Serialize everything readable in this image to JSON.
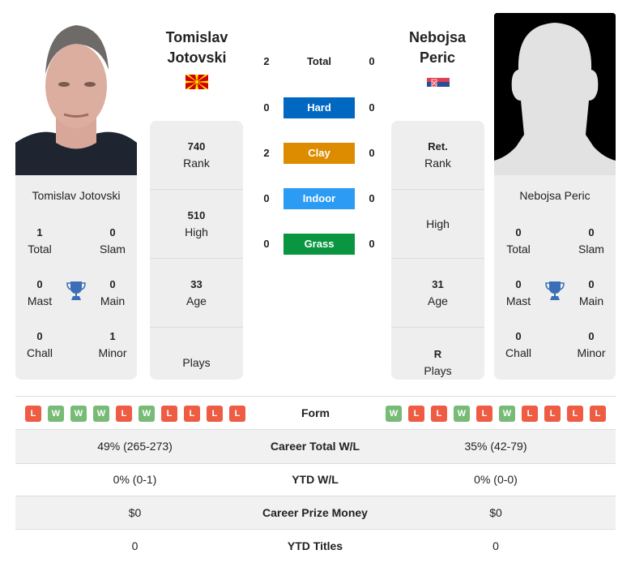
{
  "players": {
    "left": {
      "first_name": "Tomislav",
      "last_name": "Jotovski",
      "full_name": "Tomislav Jotovski",
      "country_flag": "north-macedonia-flag",
      "titles": {
        "total": "1",
        "total_label": "Total",
        "slam": "0",
        "slam_label": "Slam",
        "mast": "0",
        "mast_label": "Mast",
        "main": "0",
        "main_label": "Main",
        "chall": "0",
        "chall_label": "Chall",
        "minor": "1",
        "minor_label": "Minor"
      },
      "stats": {
        "rank": "740",
        "rank_label": "Rank",
        "high": "510",
        "high_label": "High",
        "age": "33",
        "age_label": "Age",
        "plays": "",
        "plays_label": "Plays"
      }
    },
    "right": {
      "first_name": "Nebojsa",
      "last_name": "Peric",
      "full_name": "Nebojsa Peric",
      "country_flag": "serbia-flag",
      "titles": {
        "total": "0",
        "total_label": "Total",
        "slam": "0",
        "slam_label": "Slam",
        "mast": "0",
        "mast_label": "Mast",
        "main": "0",
        "main_label": "Main",
        "chall": "0",
        "chall_label": "Chall",
        "minor": "0",
        "minor_label": "Minor"
      },
      "stats": {
        "rank": "Ret.",
        "rank_label": "Rank",
        "high": "",
        "high_label": "High",
        "age": "31",
        "age_label": "Age",
        "plays": "R",
        "plays_label": "Plays"
      }
    }
  },
  "h2h": [
    {
      "label": "Total",
      "left": "2",
      "right": "0",
      "color": ""
    },
    {
      "label": "Hard",
      "left": "0",
      "right": "0",
      "color": "#0068c0"
    },
    {
      "label": "Clay",
      "left": "2",
      "right": "0",
      "color": "#dd8c00"
    },
    {
      "label": "Indoor",
      "left": "0",
      "right": "0",
      "color": "#2b9bf4"
    },
    {
      "label": "Grass",
      "left": "0",
      "right": "0",
      "color": "#0a9640"
    }
  ],
  "form": {
    "label": "Form",
    "left": [
      "L",
      "W",
      "W",
      "W",
      "L",
      "W",
      "L",
      "L",
      "L",
      "L"
    ],
    "right": [
      "W",
      "L",
      "L",
      "W",
      "L",
      "W",
      "L",
      "L",
      "L",
      "L"
    ]
  },
  "comparison": [
    {
      "label": "Career Total W/L",
      "left": "49% (265-273)",
      "right": "35% (42-79)"
    },
    {
      "label": "YTD W/L",
      "left": "0% (0-1)",
      "right": "0% (0-0)"
    },
    {
      "label": "Career Prize Money",
      "left": "$0",
      "right": "$0"
    },
    {
      "label": "YTD Titles",
      "left": "0",
      "right": "0"
    }
  ],
  "colors": {
    "win": "#77bb77",
    "loss": "#ee5c44",
    "trophy": "#3a6fb7"
  }
}
